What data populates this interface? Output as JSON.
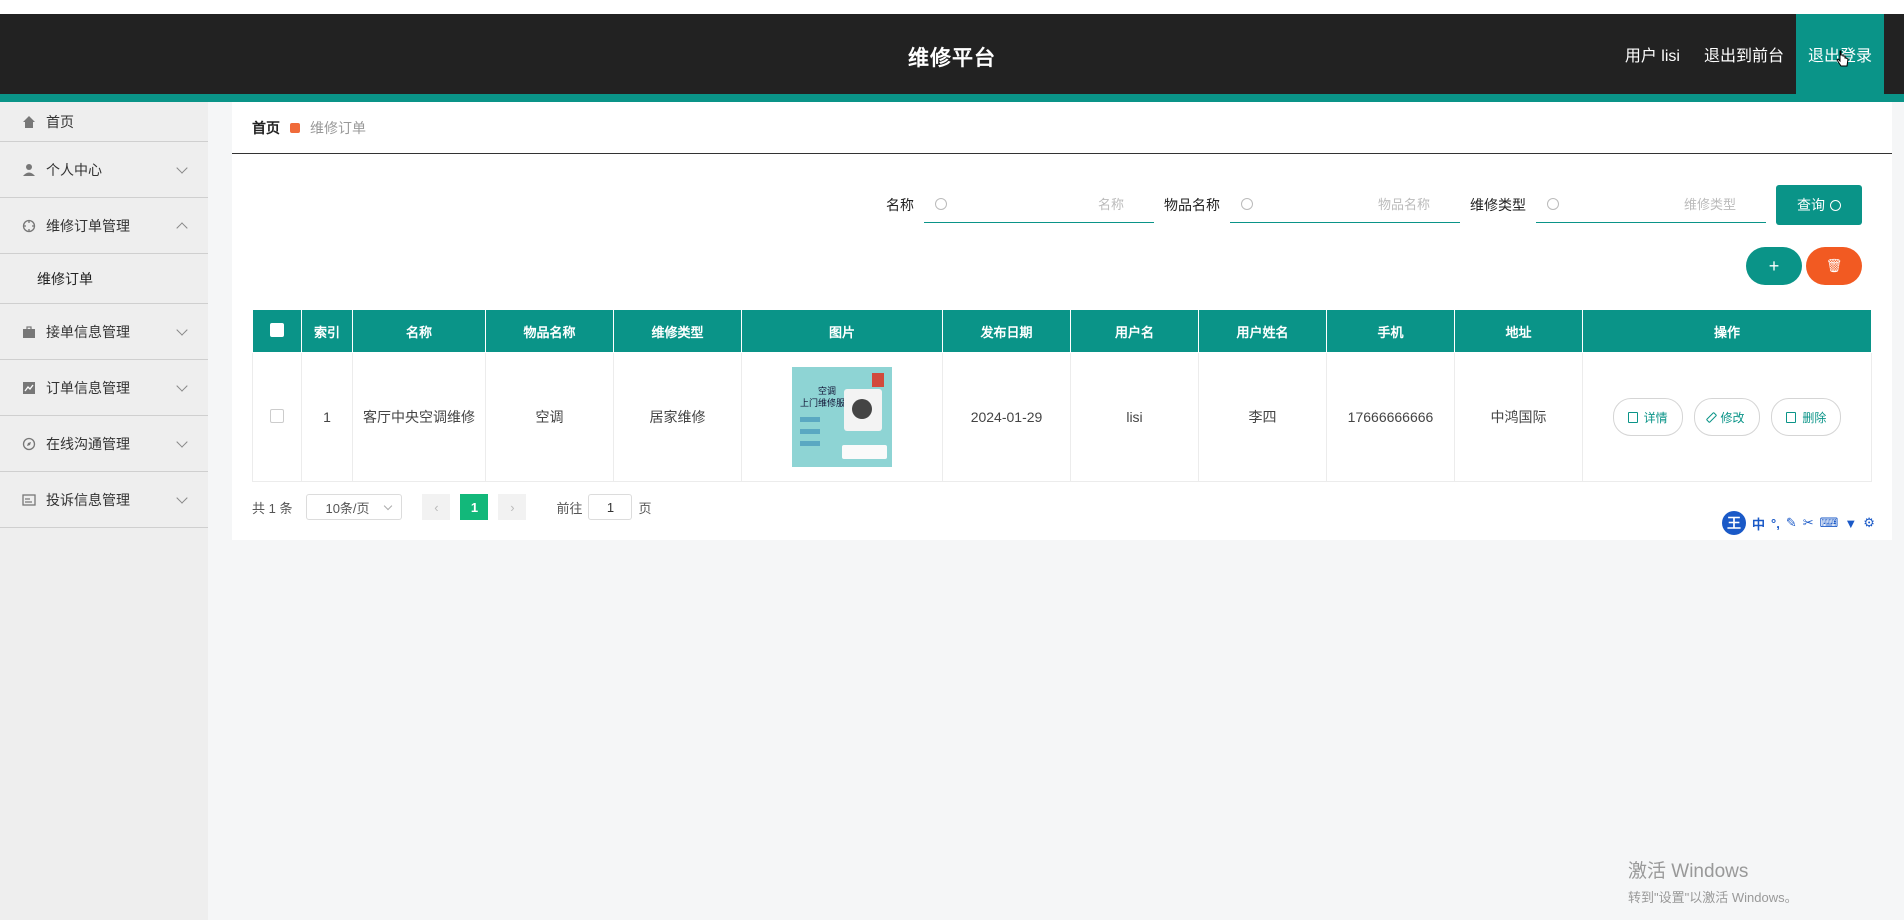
{
  "header": {
    "title": "维修平台",
    "user_label": "用户 lisi",
    "to_front_label": "退出到前台",
    "logout_label": "退出登录"
  },
  "sidebar": {
    "items": [
      {
        "label": "首页",
        "icon": "home-icon"
      },
      {
        "label": "个人中心",
        "icon": "user-icon"
      },
      {
        "label": "维修订单管理",
        "icon": "crosshair-icon",
        "expanded": true
      },
      {
        "label": "维修订单",
        "sub": true
      },
      {
        "label": "接单信息管理",
        "icon": "briefcase-icon"
      },
      {
        "label": "订单信息管理",
        "icon": "chart-icon"
      },
      {
        "label": "在线沟通管理",
        "icon": "compass-icon"
      },
      {
        "label": "投诉信息管理",
        "icon": "card-icon"
      }
    ]
  },
  "breadcrumb": {
    "home": "首页",
    "current": "维修订单"
  },
  "search": {
    "name_label": "名称",
    "name_placeholder": "名称",
    "item_label": "物品名称",
    "item_placeholder": "物品名称",
    "type_label": "维修类型",
    "type_placeholder": "维修类型",
    "query_label": "查询"
  },
  "actions": {
    "add_symbol": "+",
    "delete_symbol": "🗑"
  },
  "table": {
    "headers": [
      "索引",
      "名称",
      "物品名称",
      "维修类型",
      "图片",
      "发布日期",
      "用户名",
      "用户姓名",
      "手机",
      "地址",
      "操作"
    ],
    "rows": [
      {
        "index": "1",
        "name": "客厅中央空调维修",
        "item": "空调",
        "type": "居家维修",
        "image_text": "空调\n上门维修服务",
        "date": "2024-01-29",
        "username": "lisi",
        "realname": "李四",
        "phone": "17666666666",
        "address": "中鸿国际"
      }
    ],
    "ops": {
      "detail": "详情",
      "edit": "修改",
      "delete": "删除"
    }
  },
  "pager": {
    "total": "共 1 条",
    "page_size": "10条/页",
    "current_page": "1",
    "goto_label": "前往",
    "goto_value": "1",
    "page_unit": "页"
  },
  "ime": {
    "logo": "王",
    "mode": "中"
  },
  "watermark": {
    "line1": "激活 Windows",
    "line2": "转到\"设置\"以激活 Windows。"
  },
  "colors": {
    "accent": "#0a9488",
    "danger": "#f25a22",
    "header_bg": "#222222",
    "page_active": "#12b87a"
  }
}
